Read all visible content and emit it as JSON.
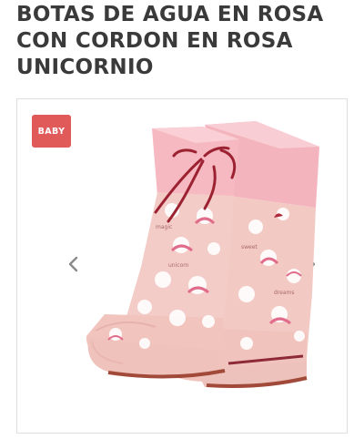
{
  "product": {
    "title": "BOTAS DE AGUA EN ROSA CON CORDON EN ROSA UNICORNIO",
    "badge": "BABY",
    "image_icon": "pink-rain-boots-unicorn-print"
  },
  "gallery": {
    "prev_icon": "chevron-left-icon",
    "next_icon": "chevron-right-icon"
  },
  "colors": {
    "badge_bg": "#e05a5a",
    "boot_pink": "#f3c9c4",
    "cuff_pink": "#f6b9c1",
    "lace_red": "#9c2232",
    "title_text": "#3a3a3a",
    "border": "#dedede",
    "arrow": "#8a8a8a"
  }
}
